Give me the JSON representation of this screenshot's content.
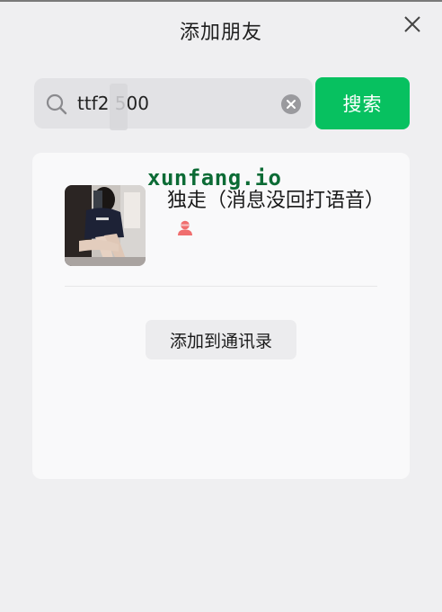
{
  "dialog": {
    "title": "添加朋友",
    "close_icon": "close-icon"
  },
  "search": {
    "value": "ttf2 500",
    "search_icon": "search-icon",
    "clear_icon": "clear-icon",
    "button_label": "搜索"
  },
  "result": {
    "watermark": "xunfang.io",
    "nickname": "独走（消息没回打语音）",
    "gender_icon": "female-icon",
    "add_button_label": "添加到通讯录"
  },
  "colors": {
    "accent_green": "#07c160",
    "gender_female": "#f06e6e"
  }
}
